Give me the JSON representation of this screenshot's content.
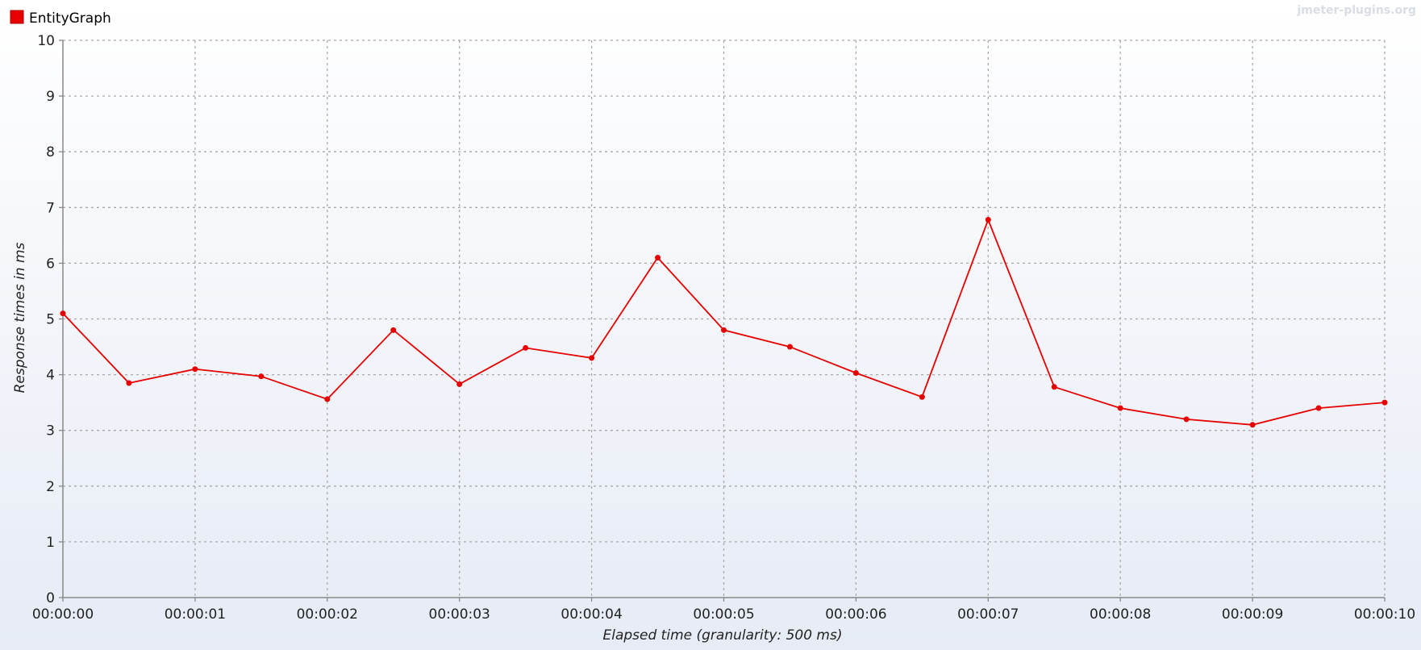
{
  "watermark": "jmeter-plugins.org",
  "chart_data": {
    "type": "line",
    "title": "",
    "xlabel": "Elapsed time (granularity: 500 ms)",
    "ylabel": "Response times in ms",
    "ylim": [
      0,
      10
    ],
    "yticks": [
      "0",
      "1",
      "2",
      "3",
      "4",
      "5",
      "6",
      "7",
      "8",
      "9",
      "10"
    ],
    "xticks": [
      "00:00:00",
      "00:00:01",
      "00:00:02",
      "00:00:03",
      "00:00:04",
      "00:00:05",
      "00:00:06",
      "00:00:07",
      "00:00:08",
      "00:00:09",
      "00:00:10"
    ],
    "grid": true,
    "legend_position": "top-left",
    "series": [
      {
        "name": "EntityGraph",
        "color": "#e60000",
        "x": [
          "00:00:00",
          "00:00:00.5",
          "00:00:01",
          "00:00:01.5",
          "00:00:02",
          "00:00:02.5",
          "00:00:03",
          "00:00:03.5",
          "00:00:04",
          "00:00:04.5",
          "00:00:05",
          "00:00:05.5",
          "00:00:06",
          "00:00:06.5",
          "00:00:07",
          "00:00:07.5",
          "00:00:08",
          "00:00:08.5",
          "00:00:09",
          "00:00:09.5",
          "00:00:10"
        ],
        "values": [
          5.1,
          3.85,
          4.1,
          3.97,
          3.56,
          4.8,
          3.83,
          4.48,
          4.3,
          6.1,
          4.8,
          4.5,
          4.03,
          3.6,
          6.78,
          3.78,
          3.4,
          3.2,
          3.1,
          3.4,
          3.5
        ]
      }
    ]
  }
}
